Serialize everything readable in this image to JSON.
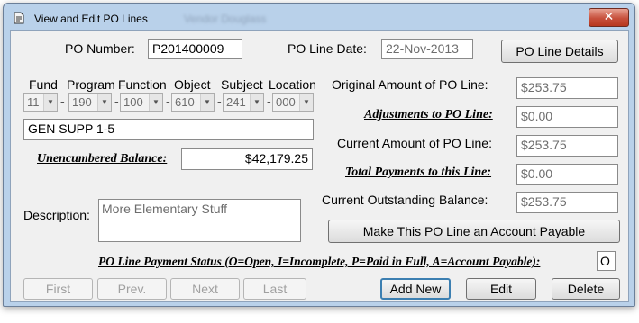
{
  "window": {
    "title": "View and Edit PO Lines",
    "title_blur": "Vendor  Douglass",
    "close_glyph": "✕"
  },
  "header": {
    "po_number_label": "PO Number:",
    "po_number_value": "P201400009",
    "po_line_date_label": "PO Line Date:",
    "po_line_date_value": "22-Nov-2013",
    "po_line_details_button": "PO Line Details"
  },
  "account": {
    "labels": {
      "fund": "Fund",
      "program": "Program",
      "function": "Function",
      "object": "Object",
      "subject": "Subject",
      "location": "Location"
    },
    "values": {
      "fund": "11",
      "program": "190",
      "function": "100",
      "object": "610",
      "subject": "241",
      "location": "000"
    },
    "separator": "-",
    "dropdown_glyph": "▼",
    "account_name": "GEN SUPP 1-5"
  },
  "balance": {
    "unencumbered_label": "Unencumbered Balance:",
    "unencumbered_value": "$42,179.25"
  },
  "description": {
    "label": "Description:",
    "value": "More Elementary Stuff"
  },
  "amounts": {
    "original_label": "Original Amount of PO Line:",
    "original_value": "$253.75",
    "adjustments_label": "Adjustments to PO Line:",
    "adjustments_value": "$0.00",
    "current_label": "Current Amount of PO Line:",
    "current_value": "$253.75",
    "total_payments_label": "Total Payments to this Line:",
    "total_payments_value": "$0.00",
    "outstanding_label": "Current Outstanding Balance:",
    "outstanding_value": "$253.75"
  },
  "payable_button": "Make This PO Line an Account Payable",
  "status": {
    "label": "PO Line Payment Status (O=Open, I=Incomplete, P=Paid in Full, A=Account Payable):",
    "value": "O"
  },
  "nav": {
    "first": "First",
    "prev": "Prev.",
    "next": "Next",
    "last": "Last",
    "add_new": "Add New",
    "edit": "Edit",
    "delete": "Delete"
  }
}
